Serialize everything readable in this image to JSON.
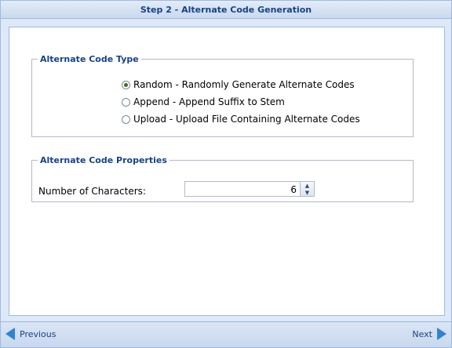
{
  "header": {
    "title": "Step 2 - Alternate Code Generation"
  },
  "code_type": {
    "legend": "Alternate Code Type",
    "options": [
      {
        "label": "Random - Randomly Generate Alternate Codes",
        "checked": true
      },
      {
        "label": "Append - Append Suffix to Stem",
        "checked": false
      },
      {
        "label": "Upload - Upload File Containing Alternate Codes",
        "checked": false
      }
    ]
  },
  "properties": {
    "legend": "Alternate Code Properties",
    "num_chars_label": "Number of Characters:",
    "num_chars_value": "6"
  },
  "footer": {
    "previous_label": "Previous",
    "next_label": "Next"
  },
  "colors": {
    "accent": "#15428b",
    "border": "#99bbe8",
    "arrow": "#2f82d6"
  }
}
